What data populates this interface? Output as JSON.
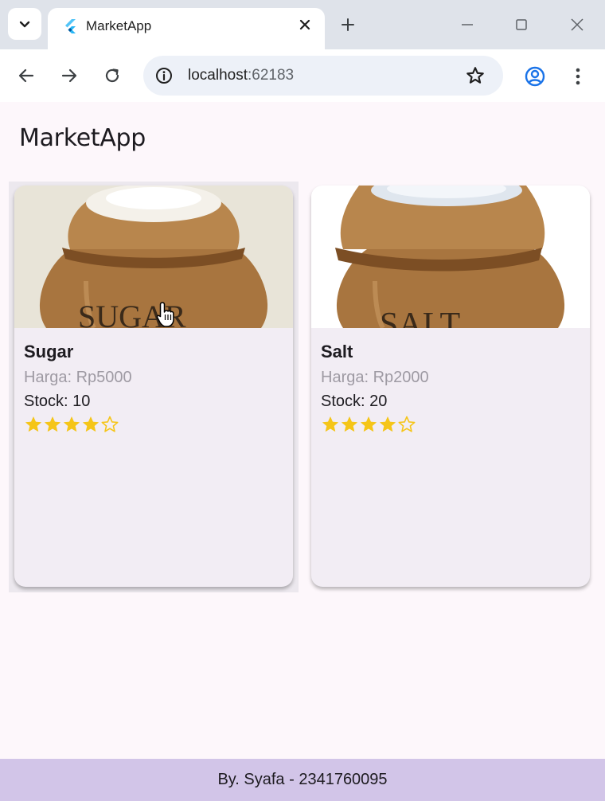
{
  "browser": {
    "tab_title": "MarketApp",
    "url_host": "localhost",
    "url_port": ":62183"
  },
  "app": {
    "title": "MarketApp",
    "products": [
      {
        "name": "Sugar",
        "price": "Harga: Rp5000",
        "stock": "Stock: 10",
        "rating": 4,
        "max_rating": 5,
        "image_label": "SUGAR"
      },
      {
        "name": "Salt",
        "price": "Harga: Rp2000",
        "stock": "Stock: 20",
        "rating": 4,
        "max_rating": 5,
        "image_label": "SALT"
      }
    ],
    "footer": "By. Syafa - 2341760095"
  },
  "colors": {
    "star": "#f5c518",
    "footer_bg": "#d2c5e8",
    "card_bg": "#f2edf4",
    "page_bg": "#fdf7fb"
  },
  "icons": {
    "tab_search": "chevron-down-icon",
    "favicon": "flutter-icon",
    "close": "close-icon",
    "new_tab": "plus-icon",
    "back": "arrow-left-icon",
    "forward": "arrow-right-icon",
    "reload": "reload-icon",
    "site_info": "info-icon",
    "bookmark": "star-outline-icon",
    "profile": "account-icon",
    "menu": "kebab-menu-icon"
  }
}
